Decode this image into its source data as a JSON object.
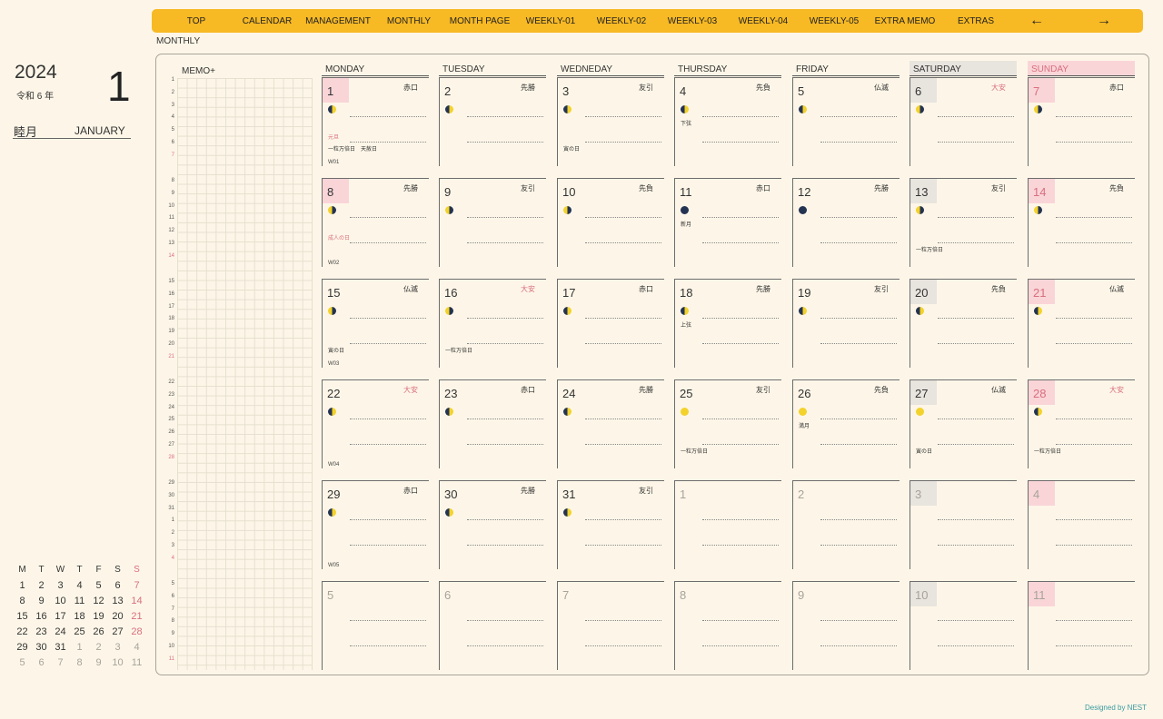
{
  "nav": {
    "items": [
      "TOP",
      "CALENDAR",
      "MANAGEMENT",
      "MONTHLY",
      "MONTH PAGE",
      "WEEKLY-01",
      "WEEKLY-02",
      "WEEKLY-03",
      "WEEKLY-04",
      "WEEKLY-05",
      "EXTRA MEMO",
      "EXTRAS"
    ],
    "prev": "←",
    "next": "→"
  },
  "breadcrumb": "MONTHLY",
  "header": {
    "year": "2024",
    "era": "令和 6 年",
    "month_number": "1",
    "month_jp": "睦月",
    "month_en": "JANUARY"
  },
  "memo_title": "MEMO+",
  "mini_calendar": {
    "headers": [
      "M",
      "T",
      "W",
      "T",
      "F",
      "S",
      "S"
    ],
    "weeks": [
      [
        "1",
        "2",
        "3",
        "4",
        "5",
        "6",
        "7"
      ],
      [
        "8",
        "9",
        "10",
        "11",
        "12",
        "13",
        "14"
      ],
      [
        "15",
        "16",
        "17",
        "18",
        "19",
        "20",
        "21"
      ],
      [
        "22",
        "23",
        "24",
        "25",
        "26",
        "27",
        "28"
      ],
      [
        "29",
        "30",
        "31",
        "1",
        "2",
        "3",
        "4"
      ],
      [
        "5",
        "6",
        "7",
        "8",
        "9",
        "10",
        "11"
      ]
    ]
  },
  "weekdays": [
    "MONDAY",
    "TUESDAY",
    "WEDNEDAY",
    "THURSDAY",
    "FRIDAY",
    "SATURDAY",
    "SUNDAY"
  ],
  "weeks": [
    {
      "label": "W01",
      "row_numbers": [
        "1",
        "2",
        "3",
        "4",
        "5",
        "6",
        "7"
      ],
      "days": [
        {
          "n": "1",
          "r": "赤口",
          "m": "fq",
          "notes": [
            {
              "t": "元旦",
              "red": true
            },
            {
              "t": "一粒万倍日　天赦日"
            }
          ]
        },
        {
          "n": "2",
          "r": "先勝",
          "m": "fq"
        },
        {
          "n": "3",
          "r": "友引",
          "m": "fq",
          "notes": [
            {
              "t": "寅の日"
            }
          ]
        },
        {
          "n": "4",
          "r": "先負",
          "m": "fq",
          "notes": [
            {
              "t": "下弦"
            }
          ]
        },
        {
          "n": "5",
          "r": "仏滅",
          "m": "fq"
        },
        {
          "n": "6",
          "r": "大安",
          "red": true,
          "m": "lq"
        },
        {
          "n": "7",
          "r": "赤口",
          "m": "lq"
        }
      ]
    },
    {
      "label": "W02",
      "row_numbers": [
        "8",
        "9",
        "10",
        "11",
        "12",
        "13",
        "14"
      ],
      "days": [
        {
          "n": "8",
          "r": "先勝",
          "m": "lq",
          "notes": [
            {
              "t": "成人の日",
              "red": true
            }
          ]
        },
        {
          "n": "9",
          "r": "友引",
          "m": "lq"
        },
        {
          "n": "10",
          "r": "先負",
          "m": "lq"
        },
        {
          "n": "11",
          "r": "赤口",
          "m": "new",
          "notes": [
            {
              "t": "新月"
            }
          ]
        },
        {
          "n": "12",
          "r": "先勝",
          "m": "new"
        },
        {
          "n": "13",
          "r": "友引",
          "m": "lq",
          "notes": [
            {
              "t": "一粒万倍日"
            }
          ]
        },
        {
          "n": "14",
          "r": "先負",
          "m": "lq"
        }
      ]
    },
    {
      "label": "W03",
      "row_numbers": [
        "15",
        "16",
        "17",
        "18",
        "19",
        "20",
        "21"
      ],
      "days": [
        {
          "n": "15",
          "r": "仏滅",
          "m": "lq",
          "notes": [
            {
              "t": "寅の日"
            }
          ]
        },
        {
          "n": "16",
          "r": "大安",
          "red": true,
          "m": "lq",
          "notes": [
            {
              "t": "一粒万倍日"
            }
          ]
        },
        {
          "n": "17",
          "r": "赤口",
          "m": "fq"
        },
        {
          "n": "18",
          "r": "先勝",
          "m": "fq",
          "notes": [
            {
              "t": "上弦"
            }
          ]
        },
        {
          "n": "19",
          "r": "友引",
          "m": "fq"
        },
        {
          "n": "20",
          "r": "先負",
          "m": "fq"
        },
        {
          "n": "21",
          "r": "仏滅",
          "m": "fq"
        }
      ]
    },
    {
      "label": "W04",
      "row_numbers": [
        "22",
        "23",
        "24",
        "25",
        "26",
        "27",
        "28"
      ],
      "days": [
        {
          "n": "22",
          "r": "大安",
          "red": true,
          "m": "fq"
        },
        {
          "n": "23",
          "r": "赤口",
          "m": "fq"
        },
        {
          "n": "24",
          "r": "先勝",
          "m": "fq"
        },
        {
          "n": "25",
          "r": "友引",
          "m": "full",
          "notes": [
            {
              "t": "一粒万倍日"
            }
          ]
        },
        {
          "n": "26",
          "r": "先負",
          "m": "full",
          "notes": [
            {
              "t": "満月"
            }
          ]
        },
        {
          "n": "27",
          "r": "仏滅",
          "m": "full",
          "notes": [
            {
              "t": "寅の日"
            }
          ]
        },
        {
          "n": "28",
          "r": "大安",
          "red": true,
          "m": "fq",
          "notes": [
            {
              "t": "一粒万倍日"
            }
          ]
        }
      ]
    },
    {
      "label": "W05",
      "row_numbers": [
        "29",
        "30",
        "31",
        "1",
        "2",
        "3",
        "4"
      ],
      "days": [
        {
          "n": "29",
          "r": "赤口",
          "m": "fq"
        },
        {
          "n": "30",
          "r": "先勝",
          "m": "fq"
        },
        {
          "n": "31",
          "r": "友引",
          "m": "fq"
        },
        {
          "n": "1",
          "out": true
        },
        {
          "n": "2",
          "out": true
        },
        {
          "n": "3",
          "out": true
        },
        {
          "n": "4",
          "out": true
        }
      ]
    },
    {
      "label": "",
      "row_numbers": [
        "5",
        "6",
        "7",
        "8",
        "9",
        "10",
        "11"
      ],
      "days": [
        {
          "n": "5",
          "out": true
        },
        {
          "n": "6",
          "out": true
        },
        {
          "n": "7",
          "out": true
        },
        {
          "n": "8",
          "out": true
        },
        {
          "n": "9",
          "out": true
        },
        {
          "n": "10",
          "out": true
        },
        {
          "n": "11",
          "out": true
        }
      ]
    }
  ],
  "credit": "Designed by NEST",
  "colors": {
    "nav": "#f7b924",
    "sunday": "#d96e7f",
    "saturday_bg": "#e8e4de",
    "sunday_bg": "#f9d5d8",
    "new_moon": "#243352",
    "moon_light": "#f3d22c"
  }
}
